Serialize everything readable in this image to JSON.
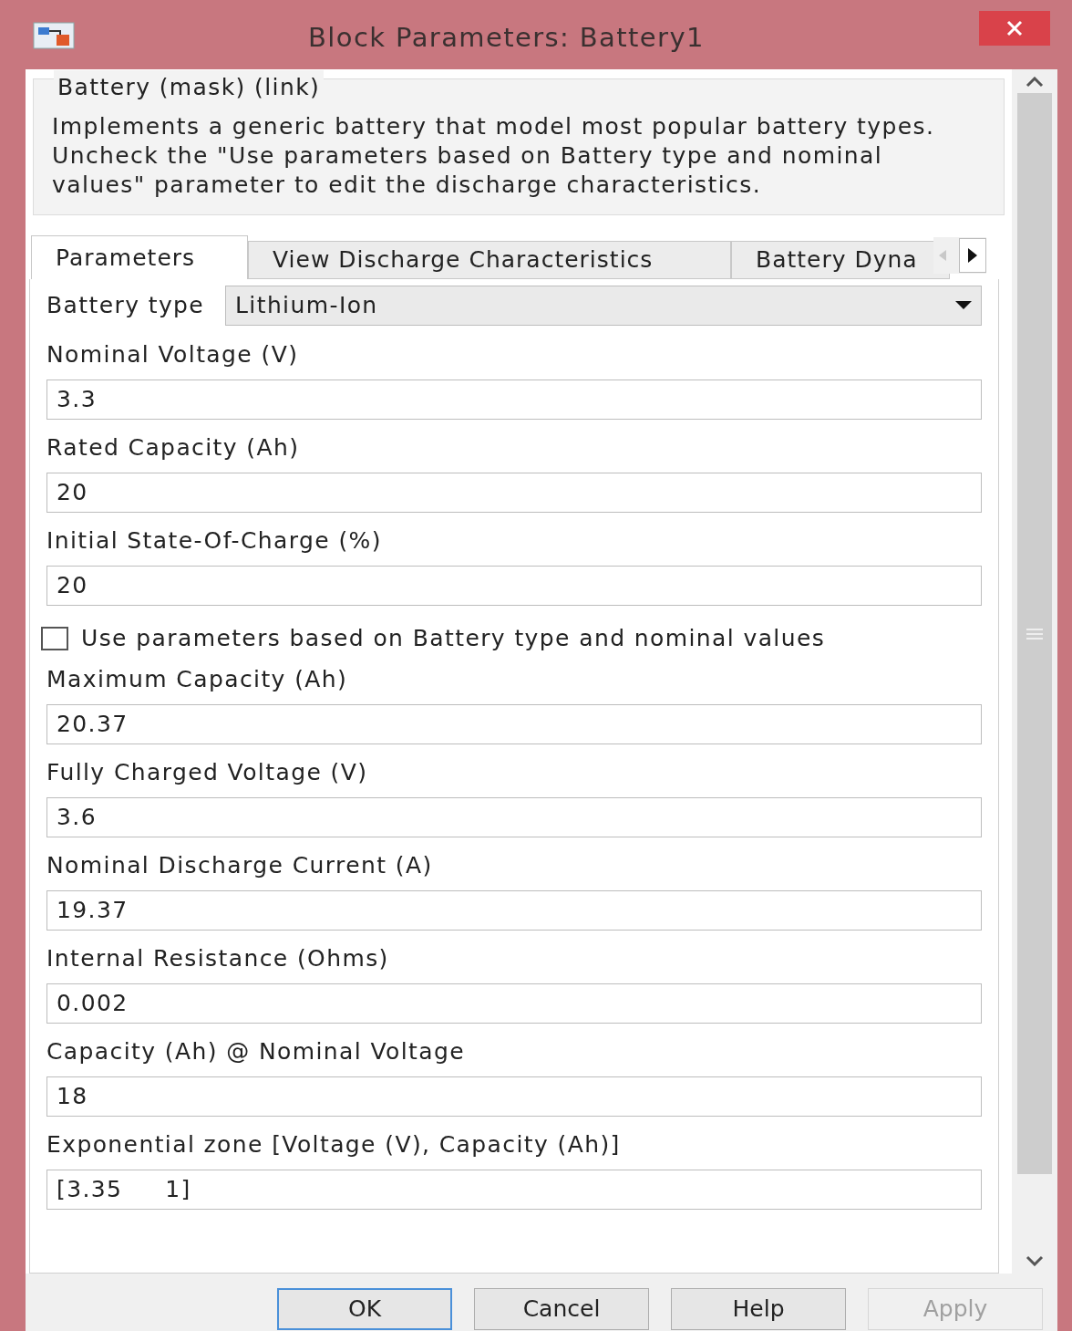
{
  "window": {
    "title": "Block Parameters: Battery1"
  },
  "mask_title": "Battery (mask) (link)",
  "description": "Implements a generic battery that model most popular battery types. Uncheck the \"Use parameters based on Battery type and nominal values\" parameter to edit the discharge characteristics.",
  "tabs": [
    {
      "label": "Parameters",
      "selected": true
    },
    {
      "label": "View Discharge Characteristics",
      "selected": false
    },
    {
      "label": "Battery Dyna",
      "selected": false
    }
  ],
  "battery_type": {
    "label": "Battery type",
    "value": "Lithium-Ion"
  },
  "parameters": [
    {
      "kind": "field",
      "label": "Nominal Voltage (V)",
      "value": "3.3"
    },
    {
      "kind": "field",
      "label": "Rated Capacity (Ah)",
      "value": "20"
    },
    {
      "kind": "field",
      "label": "Initial State-Of-Charge (%)",
      "value": "20"
    },
    {
      "kind": "checkbox",
      "label": "Use parameters based on Battery type and nominal values",
      "checked": false
    },
    {
      "kind": "field",
      "label": "Maximum Capacity (Ah)",
      "value": "20.37"
    },
    {
      "kind": "field",
      "label": "Fully Charged Voltage (V)",
      "value": "3.6"
    },
    {
      "kind": "field",
      "label": "Nominal Discharge Current (A)",
      "value": "19.37"
    },
    {
      "kind": "field",
      "label": "Internal Resistance (Ohms)",
      "value": "0.002"
    },
    {
      "kind": "field",
      "label": "Capacity (Ah) @ Nominal Voltage",
      "value": "18"
    },
    {
      "kind": "field",
      "label": "Exponential zone [Voltage (V), Capacity (Ah)]",
      "value": "[3.35     1]"
    }
  ],
  "buttons": [
    {
      "label": "OK",
      "disabled": false,
      "default": true
    },
    {
      "label": "Cancel",
      "disabled": false,
      "default": false
    },
    {
      "label": "Help",
      "disabled": false,
      "default": false
    },
    {
      "label": "Apply",
      "disabled": true,
      "default": false
    }
  ]
}
